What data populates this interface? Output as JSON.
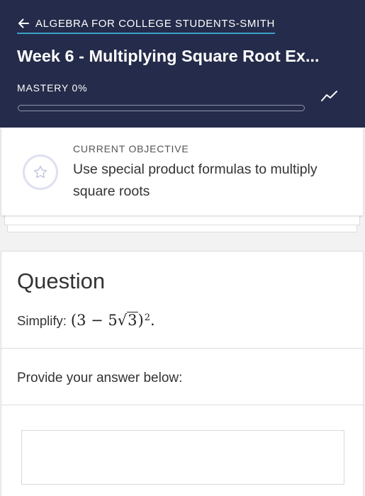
{
  "header": {
    "back_label": "ALGEBRA FOR COLLEGE STUDENTS-SMITH",
    "title": "Week 6 - Multiplying Square Root Ex...",
    "mastery_label": "MASTERY",
    "mastery_value": "0%",
    "mastery_fraction": 0,
    "accent_color": "#3aa0c8",
    "background_color": "#252b4a"
  },
  "objective": {
    "kicker": "CURRENT OBJECTIVE",
    "text": "Use special product formulas to multiply square roots",
    "icon": "star-icon"
  },
  "question": {
    "heading": "Question",
    "prompt_prefix": "Simplify:",
    "expr_open": "(3 − 5",
    "radical": "√",
    "radicand": "3",
    "expr_close": ")",
    "exponent": "2",
    "expr_end": ".",
    "answer_prompt": "Provide your answer below:",
    "answer_value": ""
  }
}
